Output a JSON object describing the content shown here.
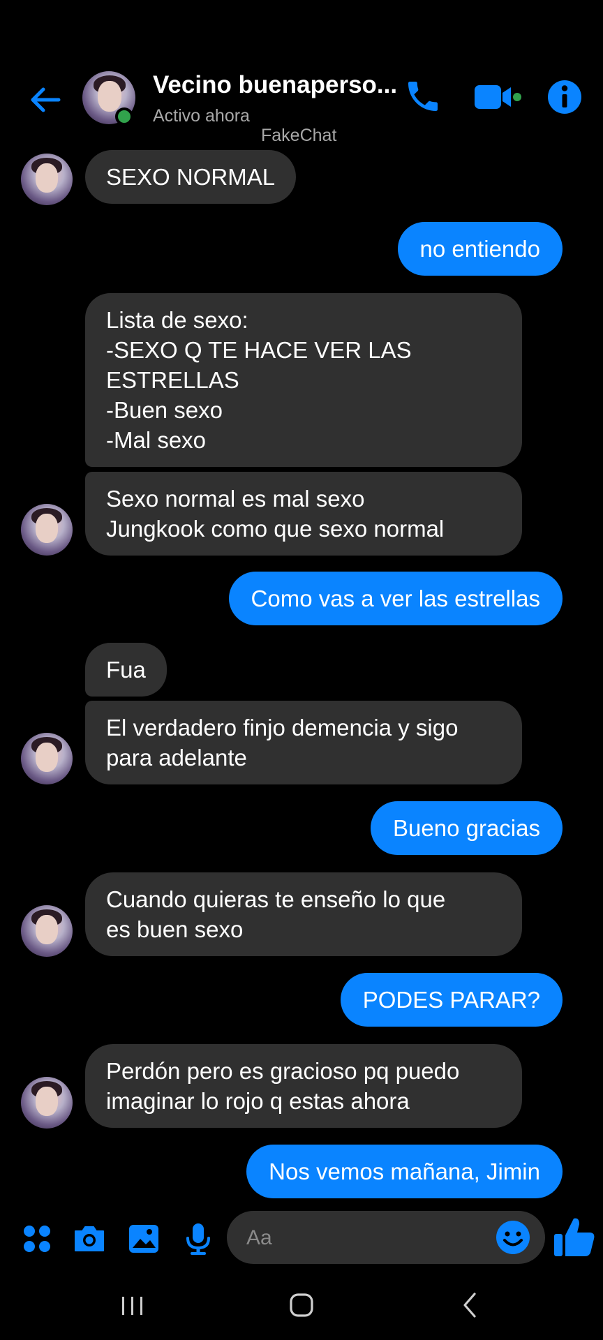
{
  "header": {
    "title": "Vecino buenaperso...",
    "status": "Activo ahora",
    "back_icon": "arrow-left-icon",
    "call_icon": "phone-icon",
    "video_icon": "video-camera-icon",
    "info_icon": "info-icon"
  },
  "watermark": "FakeChat",
  "colors": {
    "accent": "#0a84ff",
    "incoming_bubble": "#303030",
    "background": "#000000",
    "online": "#31a24c"
  },
  "messages": [
    {
      "from": "them",
      "text": "SEXO NORMAL"
    },
    {
      "from": "me",
      "text": "no entiendo"
    },
    {
      "from": "them",
      "text": "Lista de sexo:\n-SEXO Q TE HACE VER LAS ESTRELLAS\n-Buen sexo\n-Mal sexo"
    },
    {
      "from": "them",
      "text": "Sexo normal es mal sexo\nJungkook como que sexo normal"
    },
    {
      "from": "me",
      "text": "Como vas a ver las estrellas"
    },
    {
      "from": "them",
      "text": "Fua"
    },
    {
      "from": "them",
      "text": "El verdadero finjo demencia y sigo\npara adelante"
    },
    {
      "from": "me",
      "text": "Bueno gracias"
    },
    {
      "from": "them",
      "text": "Cuando quieras te enseño lo que\nes buen sexo"
    },
    {
      "from": "me",
      "text": "PODES PARAR?"
    },
    {
      "from": "them",
      "text": "Perdón pero es gracioso pq puedo\nimaginar lo rojo q estas ahora"
    },
    {
      "from": "me",
      "text": "Nos vemos mañana, Jimin"
    }
  ],
  "composer": {
    "placeholder": "Aa",
    "icons": [
      "apps-icon",
      "camera-icon",
      "image-icon",
      "microphone-icon",
      "emoji-icon",
      "thumbs-up-icon"
    ]
  },
  "navbar": {
    "icons": [
      "recent-apps-icon",
      "home-icon",
      "back-icon"
    ]
  }
}
